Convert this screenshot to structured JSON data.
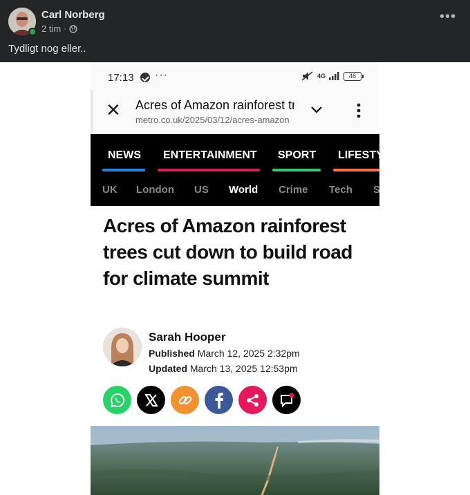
{
  "post": {
    "author": "Carl Norberg",
    "time": "2 tim",
    "caption": "Tydligt nog eller..",
    "more_icon": "more-horizontal-icon",
    "audience_icon": "globe-icon"
  },
  "phone": {
    "status_time": "17:13",
    "battery": "46",
    "network": "4G",
    "url_title": "Acres of Amazon rainforest trees cut down",
    "url_host": "metro.co.uk/2025/03/12/acres-amazon"
  },
  "nav": {
    "tabs": [
      {
        "label": "NEWS",
        "color": "#1e88e5"
      },
      {
        "label": "ENTERTAINMENT",
        "color": "#d81b60"
      },
      {
        "label": "SPORT",
        "color": "#2ecc71"
      },
      {
        "label": "LIFESTYLE",
        "color": "#ff7043"
      }
    ],
    "subtabs": [
      "UK",
      "London",
      "US",
      "World",
      "Crime",
      "Tech",
      "S"
    ],
    "active_subtab": "World"
  },
  "article": {
    "headline": "Acres of Amazon rainforest trees cut down to build road for climate summit",
    "author": "Sarah Hooper",
    "published_label": "Published",
    "published": "March 12, 2025 2:32pm",
    "updated_label": "Updated",
    "updated": "March 13, 2025 12:53pm"
  },
  "share": [
    {
      "name": "whatsapp-icon",
      "color": "#25d366"
    },
    {
      "name": "x-icon",
      "color": "#000000"
    },
    {
      "name": "link-icon",
      "color": "#f2922e"
    },
    {
      "name": "facebook-icon",
      "color": "#3b5998"
    },
    {
      "name": "share-icon",
      "color": "#e8175d"
    },
    {
      "name": "comments-icon",
      "color": "#000000"
    }
  ]
}
